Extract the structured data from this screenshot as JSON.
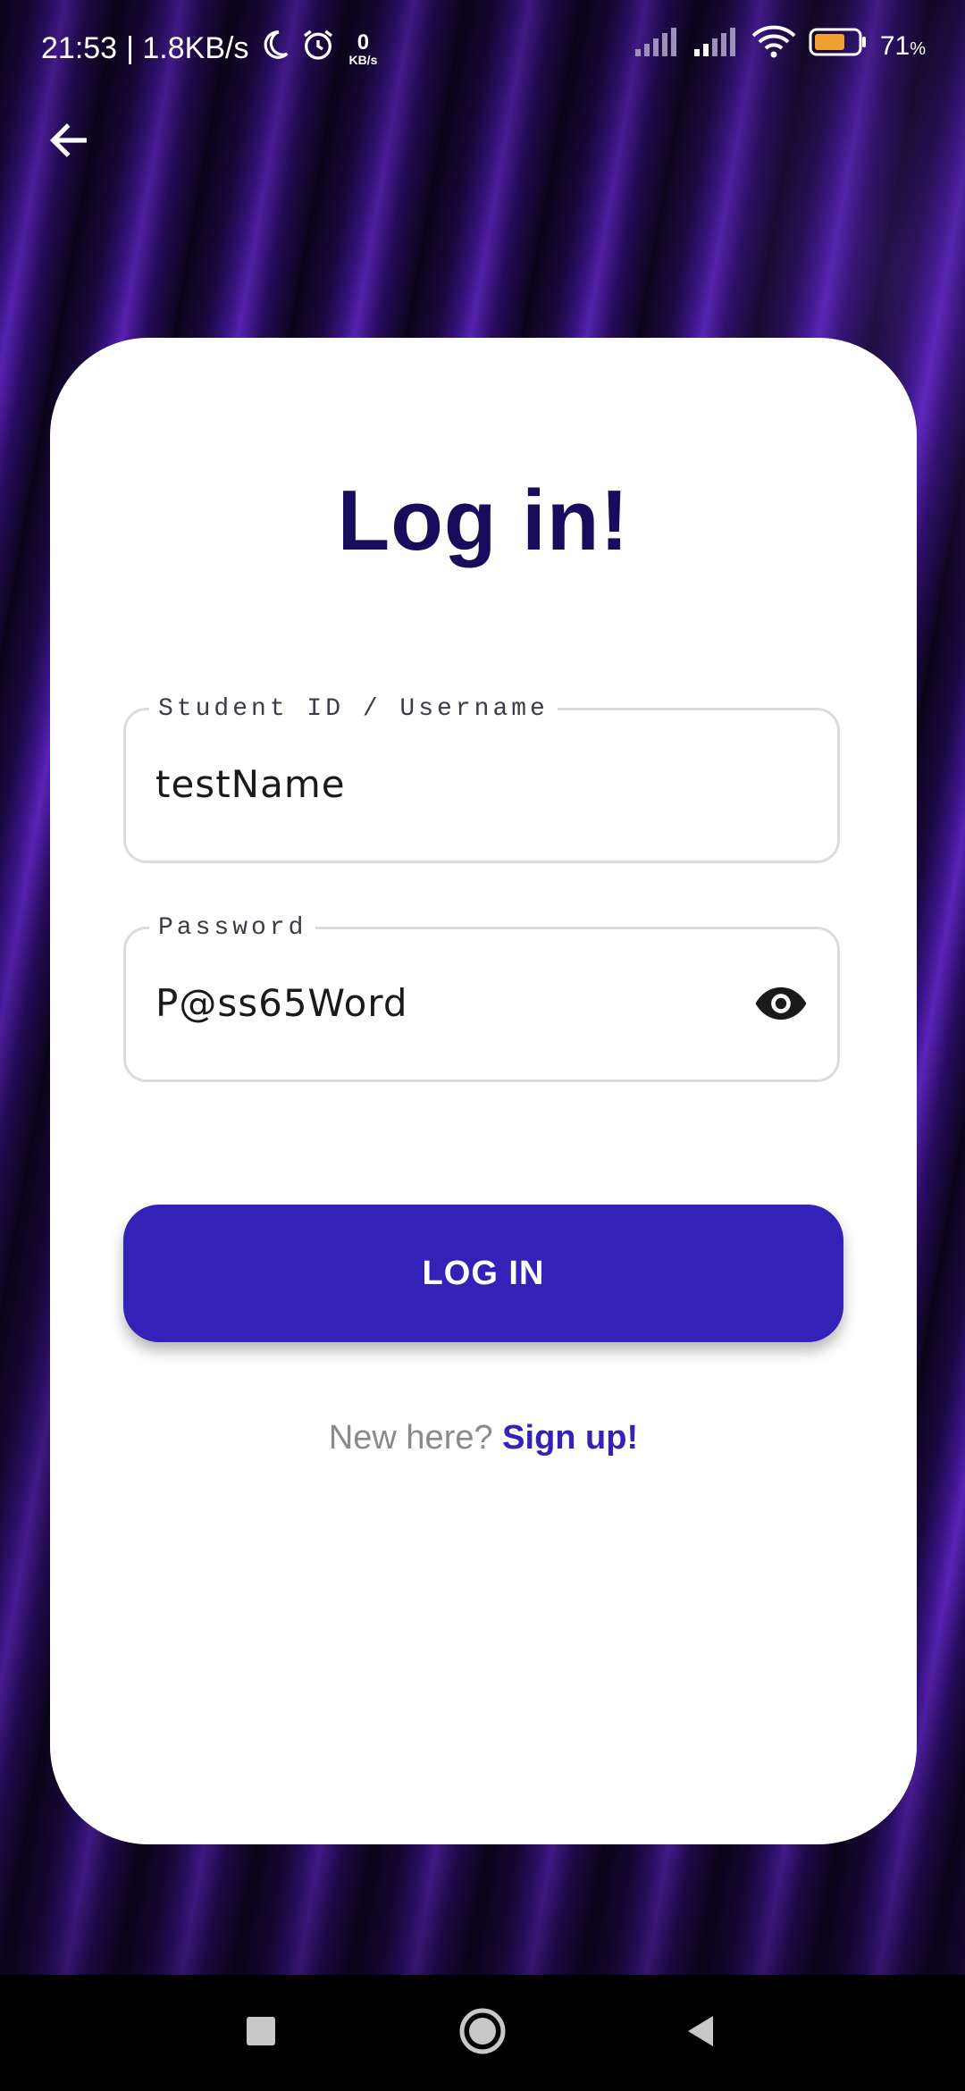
{
  "status_bar": {
    "time": "21:53",
    "network_speed": "| 1.8KB/s",
    "data_rate_value": "0",
    "data_rate_unit": "KB/s",
    "battery_percent": "71",
    "battery_percent_unit": "%",
    "battery_level": 0.71,
    "battery_color": "#f0a030",
    "icons": [
      "moon-icon",
      "alarm-icon",
      "signal-icon",
      "signal-icon",
      "wifi-icon",
      "battery-icon"
    ]
  },
  "header": {
    "back_icon": "arrow-left-icon"
  },
  "login": {
    "title": "Log in!",
    "username_label": "Student ID / Username",
    "username_value": "testName",
    "password_label": "Password",
    "password_value": "P@ss65Word",
    "password_toggle_icon": "eye-icon",
    "login_button_label": "LOG IN",
    "signup_prompt": "New here?",
    "signup_link": "Sign up!"
  },
  "nav_bar": {
    "icons": [
      "recents-square-icon",
      "home-circle-icon",
      "back-triangle-icon"
    ]
  },
  "colors": {
    "title": "#170d5c",
    "button": "#3422b8",
    "link": "#3422b8",
    "card": "#ffffff"
  }
}
